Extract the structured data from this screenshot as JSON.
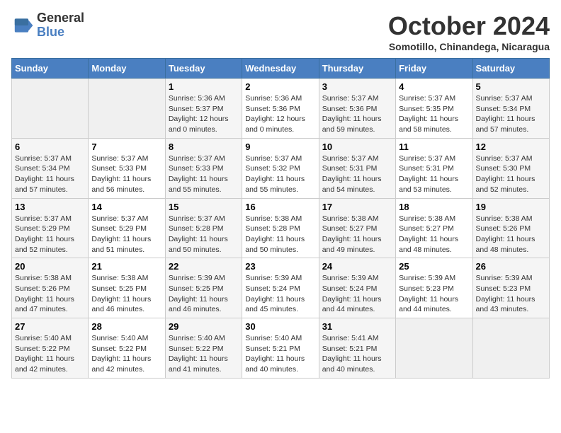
{
  "logo": {
    "line1": "General",
    "line2": "Blue"
  },
  "title": "October 2024",
  "location": "Somotillo, Chinandega, Nicaragua",
  "days_of_week": [
    "Sunday",
    "Monday",
    "Tuesday",
    "Wednesday",
    "Thursday",
    "Friday",
    "Saturday"
  ],
  "weeks": [
    [
      {
        "day": "",
        "detail": ""
      },
      {
        "day": "",
        "detail": ""
      },
      {
        "day": "1",
        "detail": "Sunrise: 5:36 AM\nSunset: 5:37 PM\nDaylight: 12 hours\nand 0 minutes."
      },
      {
        "day": "2",
        "detail": "Sunrise: 5:36 AM\nSunset: 5:36 PM\nDaylight: 12 hours\nand 0 minutes."
      },
      {
        "day": "3",
        "detail": "Sunrise: 5:37 AM\nSunset: 5:36 PM\nDaylight: 11 hours\nand 59 minutes."
      },
      {
        "day": "4",
        "detail": "Sunrise: 5:37 AM\nSunset: 5:35 PM\nDaylight: 11 hours\nand 58 minutes."
      },
      {
        "day": "5",
        "detail": "Sunrise: 5:37 AM\nSunset: 5:34 PM\nDaylight: 11 hours\nand 57 minutes."
      }
    ],
    [
      {
        "day": "6",
        "detail": "Sunrise: 5:37 AM\nSunset: 5:34 PM\nDaylight: 11 hours\nand 57 minutes."
      },
      {
        "day": "7",
        "detail": "Sunrise: 5:37 AM\nSunset: 5:33 PM\nDaylight: 11 hours\nand 56 minutes."
      },
      {
        "day": "8",
        "detail": "Sunrise: 5:37 AM\nSunset: 5:33 PM\nDaylight: 11 hours\nand 55 minutes."
      },
      {
        "day": "9",
        "detail": "Sunrise: 5:37 AM\nSunset: 5:32 PM\nDaylight: 11 hours\nand 55 minutes."
      },
      {
        "day": "10",
        "detail": "Sunrise: 5:37 AM\nSunset: 5:31 PM\nDaylight: 11 hours\nand 54 minutes."
      },
      {
        "day": "11",
        "detail": "Sunrise: 5:37 AM\nSunset: 5:31 PM\nDaylight: 11 hours\nand 53 minutes."
      },
      {
        "day": "12",
        "detail": "Sunrise: 5:37 AM\nSunset: 5:30 PM\nDaylight: 11 hours\nand 52 minutes."
      }
    ],
    [
      {
        "day": "13",
        "detail": "Sunrise: 5:37 AM\nSunset: 5:29 PM\nDaylight: 11 hours\nand 52 minutes."
      },
      {
        "day": "14",
        "detail": "Sunrise: 5:37 AM\nSunset: 5:29 PM\nDaylight: 11 hours\nand 51 minutes."
      },
      {
        "day": "15",
        "detail": "Sunrise: 5:37 AM\nSunset: 5:28 PM\nDaylight: 11 hours\nand 50 minutes."
      },
      {
        "day": "16",
        "detail": "Sunrise: 5:38 AM\nSunset: 5:28 PM\nDaylight: 11 hours\nand 50 minutes."
      },
      {
        "day": "17",
        "detail": "Sunrise: 5:38 AM\nSunset: 5:27 PM\nDaylight: 11 hours\nand 49 minutes."
      },
      {
        "day": "18",
        "detail": "Sunrise: 5:38 AM\nSunset: 5:27 PM\nDaylight: 11 hours\nand 48 minutes."
      },
      {
        "day": "19",
        "detail": "Sunrise: 5:38 AM\nSunset: 5:26 PM\nDaylight: 11 hours\nand 48 minutes."
      }
    ],
    [
      {
        "day": "20",
        "detail": "Sunrise: 5:38 AM\nSunset: 5:26 PM\nDaylight: 11 hours\nand 47 minutes."
      },
      {
        "day": "21",
        "detail": "Sunrise: 5:38 AM\nSunset: 5:25 PM\nDaylight: 11 hours\nand 46 minutes."
      },
      {
        "day": "22",
        "detail": "Sunrise: 5:39 AM\nSunset: 5:25 PM\nDaylight: 11 hours\nand 46 minutes."
      },
      {
        "day": "23",
        "detail": "Sunrise: 5:39 AM\nSunset: 5:24 PM\nDaylight: 11 hours\nand 45 minutes."
      },
      {
        "day": "24",
        "detail": "Sunrise: 5:39 AM\nSunset: 5:24 PM\nDaylight: 11 hours\nand 44 minutes."
      },
      {
        "day": "25",
        "detail": "Sunrise: 5:39 AM\nSunset: 5:23 PM\nDaylight: 11 hours\nand 44 minutes."
      },
      {
        "day": "26",
        "detail": "Sunrise: 5:39 AM\nSunset: 5:23 PM\nDaylight: 11 hours\nand 43 minutes."
      }
    ],
    [
      {
        "day": "27",
        "detail": "Sunrise: 5:40 AM\nSunset: 5:22 PM\nDaylight: 11 hours\nand 42 minutes."
      },
      {
        "day": "28",
        "detail": "Sunrise: 5:40 AM\nSunset: 5:22 PM\nDaylight: 11 hours\nand 42 minutes."
      },
      {
        "day": "29",
        "detail": "Sunrise: 5:40 AM\nSunset: 5:22 PM\nDaylight: 11 hours\nand 41 minutes."
      },
      {
        "day": "30",
        "detail": "Sunrise: 5:40 AM\nSunset: 5:21 PM\nDaylight: 11 hours\nand 40 minutes."
      },
      {
        "day": "31",
        "detail": "Sunrise: 5:41 AM\nSunset: 5:21 PM\nDaylight: 11 hours\nand 40 minutes."
      },
      {
        "day": "",
        "detail": ""
      },
      {
        "day": "",
        "detail": ""
      }
    ]
  ]
}
